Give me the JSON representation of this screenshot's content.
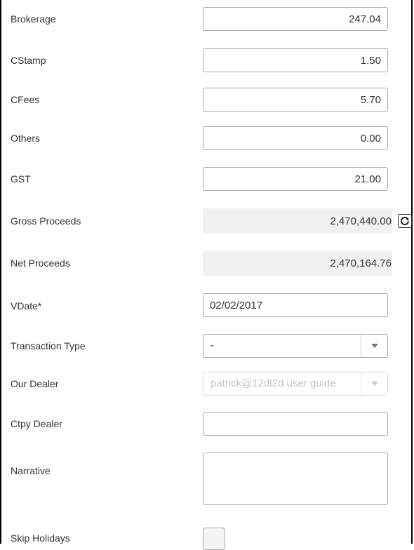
{
  "fields": {
    "brokerage": {
      "label": "Brokerage",
      "value": "247.04"
    },
    "cstamp": {
      "label": "CStamp",
      "value": "1.50"
    },
    "cfees": {
      "label": "CFees",
      "value": "5.70"
    },
    "others": {
      "label": "Others",
      "value": "0.00"
    },
    "gst": {
      "label": "GST",
      "value": "21.00"
    },
    "gross_proceeds": {
      "label": "Gross Proceeds",
      "value": "2,470,440.00"
    },
    "net_proceeds": {
      "label": "Net Proceeds",
      "value": "2,470,164.76"
    },
    "vdate": {
      "label": "VDate*",
      "value": "02/02/2017"
    },
    "transaction_type": {
      "label": "Transaction Type",
      "value": "-"
    },
    "our_dealer": {
      "label": "Our Dealer",
      "value": "patrick@12dl2d user guide"
    },
    "ctpy_dealer": {
      "label": "Ctpy Dealer",
      "value": ""
    },
    "narrative": {
      "label": "Narrative",
      "value": ""
    },
    "skip_holidays": {
      "label": "Skip Holidays",
      "checked": false
    }
  },
  "icons": {
    "refresh": "refresh-icon",
    "dropdown": "chevron-down-icon"
  },
  "colors": {
    "readonly_bg": "#f1f1f1",
    "border": "#a9a9a9",
    "disabled_text": "#c4c4c4"
  }
}
